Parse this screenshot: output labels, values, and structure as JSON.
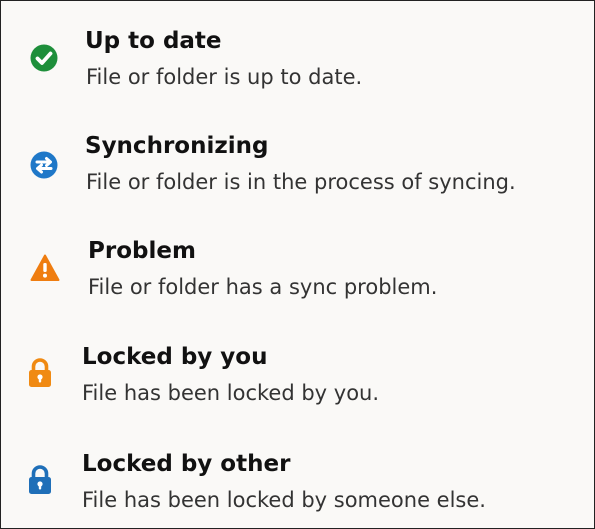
{
  "legend": {
    "items": [
      {
        "icon": "check-circle-icon",
        "color": "#1e8f3b",
        "title": "Up to date",
        "description": "File or folder is up to date."
      },
      {
        "icon": "sync-arrows-icon",
        "color": "#1f78c8",
        "title": "Synchronizing",
        "description": "File or folder is in the process of syncing."
      },
      {
        "icon": "warning-triangle-icon",
        "color": "#ef7d10",
        "title": "Problem",
        "description": "File or folder has a sync problem."
      },
      {
        "icon": "lock-orange-icon",
        "color": "#f08a12",
        "title": "Locked by you",
        "description": "File has been locked by you."
      },
      {
        "icon": "lock-blue-icon",
        "color": "#1f6fb8",
        "title": "Locked by other",
        "description": "File has been locked by someone else."
      }
    ]
  }
}
